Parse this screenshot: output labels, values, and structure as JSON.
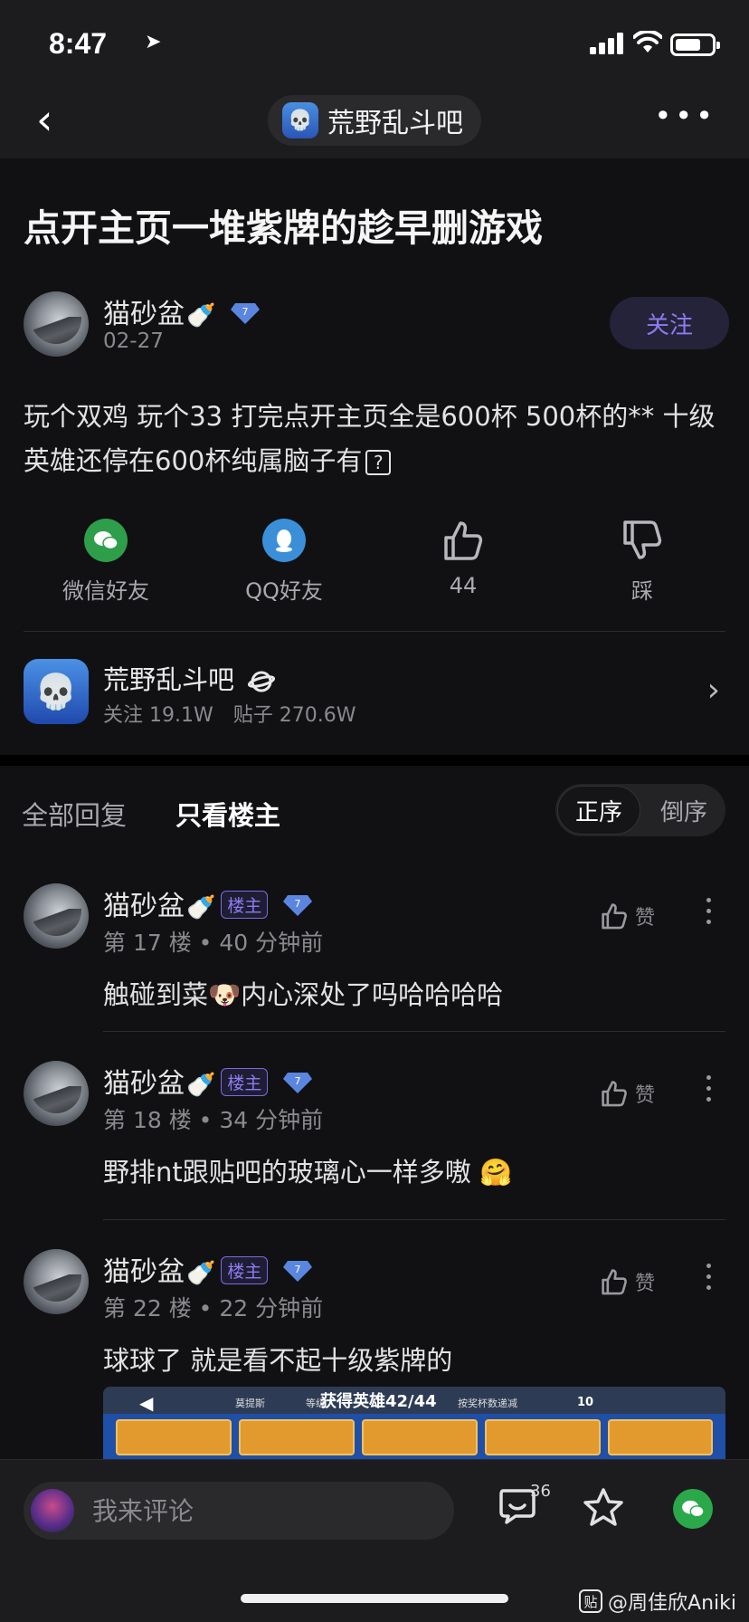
{
  "status": {
    "time": "8:47",
    "battery_level": 0.7
  },
  "nav": {
    "forum_name": "荒野乱斗吧"
  },
  "post": {
    "title": "点开主页一堆紫牌的趁早删游戏",
    "author": "猫砂盆",
    "level": "7",
    "date": "02-27",
    "follow_label": "关注",
    "content": "玩个双鸡 玩个33 打完点开主页全是600杯 500杯的** 十级英雄还停在600杯纯属脑子有",
    "content_icon": "?"
  },
  "actions": [
    {
      "label": "微信好友",
      "icon": "wechat-icon"
    },
    {
      "label": "QQ好友",
      "icon": "qq-icon"
    },
    {
      "label": "44",
      "icon": "thumbs-up-icon"
    },
    {
      "label": "踩",
      "icon": "thumbs-down-icon"
    }
  ],
  "forum_card": {
    "name": "荒野乱斗吧",
    "stats": "关注 19.1W　贴子 270.6W"
  },
  "tabs": {
    "all": "全部回复",
    "owner_only": "只看楼主",
    "sort_asc": "正序",
    "sort_desc": "倒序"
  },
  "replies": [
    {
      "author": "猫砂盆",
      "badge": "楼主",
      "level": "7",
      "meta": "第 17 楼 • 40 分钟前",
      "text": "触碰到菜🐶内心深处了吗哈哈哈哈",
      "like_label": "赞"
    },
    {
      "author": "猫砂盆",
      "badge": "楼主",
      "level": "7",
      "meta": "第 18 楼 • 34 分钟前",
      "text": "野排nt跟贴吧的玻璃心一样多嗷 🤗",
      "like_label": "赞"
    },
    {
      "author": "猫砂盆",
      "badge": "楼主",
      "level": "7",
      "meta": "第 22 楼 • 22 分钟前",
      "text": "球球了 就是看不起十级紫牌的",
      "like_label": "赞"
    }
  ],
  "image_preview": {
    "title": "获得英雄42/44",
    "sub_left": "莫提斯",
    "sub_mid": "等级",
    "sub_right": "按奖杯数递减",
    "count": "10"
  },
  "bottom": {
    "comment_placeholder": "我来评论",
    "comment_count": "36"
  },
  "watermark": "@周佳欣Aniki",
  "watermark_logo": "贴"
}
